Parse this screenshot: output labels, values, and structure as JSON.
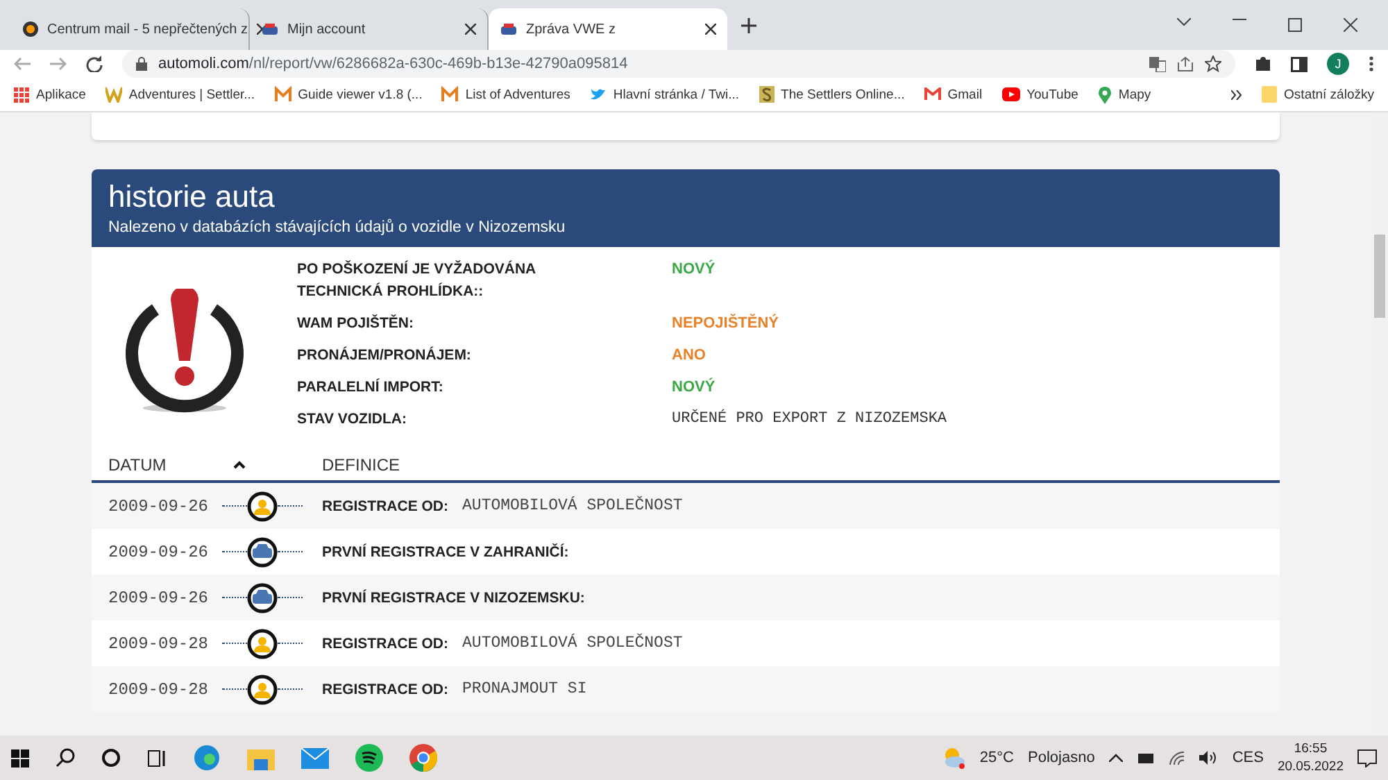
{
  "browser": {
    "tabs": [
      {
        "title": "Centrum mail - 5 nepřečtených z",
        "kind": "mail",
        "selected": false
      },
      {
        "title": "Mijn account",
        "kind": "car",
        "selected": false
      },
      {
        "title": "Zpráva VWE z",
        "kind": "car",
        "selected": true
      }
    ],
    "url": {
      "host": "automoli.com",
      "path": "/nl/report/vw/6286682a-630c-469b-b13e-42790a095814"
    },
    "profile": "J",
    "bookmarks": [
      {
        "label": "Aplikace",
        "kind": "apps"
      },
      {
        "label": "Adventures | Settler...",
        "kind": "w"
      },
      {
        "label": "Guide viewer v1.8 (...",
        "kind": "m"
      },
      {
        "label": "List of Adventures",
        "kind": "m"
      },
      {
        "label": "Hlavní stránka / Twi...",
        "kind": "bird"
      },
      {
        "label": "The Settlers Online...",
        "kind": "s"
      },
      {
        "label": "Gmail",
        "kind": "gmail"
      },
      {
        "label": "YouTube",
        "kind": "yt"
      },
      {
        "label": "Mapy",
        "kind": "pin"
      }
    ],
    "other_bookmarks": "Ostatní záložky"
  },
  "report": {
    "title": "historie auta",
    "subtitle": "Nalezeno v databázích stávajících údajů o vozidle v Nizozemsku",
    "facts": [
      {
        "label": "PO POŠKOZENÍ JE VYŽADOVÁNA TECHNICKÁ PROHLÍDKA::",
        "value": "NOVÝ",
        "kind": "status",
        "color": "#3aa845"
      },
      {
        "label": "WAM POJIŠTĚN:",
        "value": "NEPOJIŠTĚNÝ",
        "kind": "status",
        "color": "#e8822a"
      },
      {
        "label": "PRONÁJEM/PRONÁJEM:",
        "value": "ANO",
        "kind": "status",
        "color": "#e8822a"
      },
      {
        "label": "PARALELNÍ IMPORT:",
        "value": "NOVÝ",
        "kind": "status",
        "color": "#3aa845"
      },
      {
        "label": "STAV VOZIDLA:",
        "value": "URČENÉ PRO EXPORT Z NIZOZEMSKA",
        "kind": "text"
      }
    ],
    "columns": [
      {
        "label": "DATUM",
        "sorted": true
      },
      {
        "label": "DEFINICE",
        "sorted": false
      }
    ],
    "rows": [
      {
        "date": "2009-09-26",
        "kind": "person",
        "label": "REGISTRACE OD:",
        "value": "AUTOMOBILOVÁ SPOLEČNOST"
      },
      {
        "date": "2009-09-26",
        "kind": "car",
        "label": "PRVNÍ REGISTRACE V ZAHRANIČÍ:"
      },
      {
        "date": "2009-09-26",
        "kind": "car",
        "label": "PRVNÍ REGISTRACE V NIZOZEMSKU:"
      },
      {
        "date": "2009-09-28",
        "kind": "person",
        "label": "REGISTRACE OD:",
        "value": "AUTOMOBILOVÁ SPOLEČNOST"
      },
      {
        "date": "2009-09-28",
        "kind": "person",
        "label": "REGISTRACE OD:",
        "value": "PRONAJMOUT SI"
      }
    ]
  },
  "taskbar": {
    "temperature": "25°C",
    "weather": "Polojasno",
    "language": "CES",
    "time": "16:55",
    "date": "20.05.2022"
  }
}
